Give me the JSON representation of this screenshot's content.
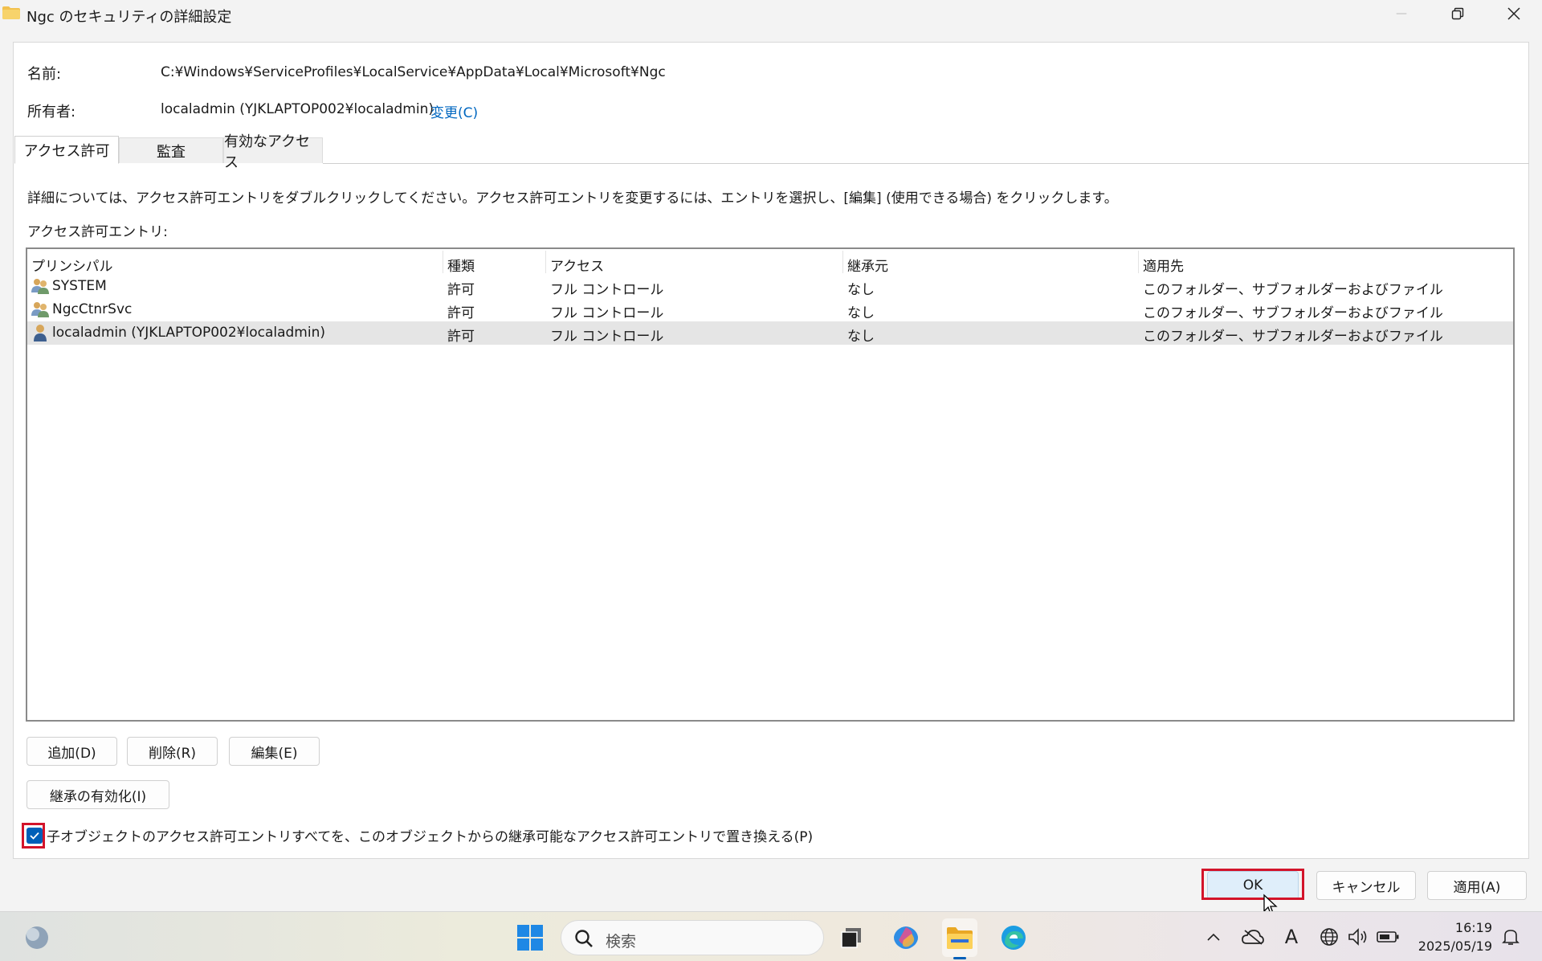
{
  "window": {
    "title": "Ngc のセキュリティの詳細設定",
    "minimize_glyph": "—",
    "icons": {
      "folder": "folder-icon",
      "minimize": "minimize-icon",
      "restore": "restore-icon",
      "close": "close-icon"
    }
  },
  "info": {
    "name_label": "名前:",
    "name_value": "C:¥Windows¥ServiceProfiles¥LocalService¥AppData¥Local¥Microsoft¥Ngc",
    "owner_label": "所有者:",
    "owner_value": "localadmin (YJKLAPTOP002¥localadmin)",
    "change_link": "変更(C)"
  },
  "tabs": [
    {
      "label": "アクセス許可",
      "active": true
    },
    {
      "label": "監査",
      "active": false
    },
    {
      "label": "有効なアクセス",
      "active": false
    }
  ],
  "instructions": "詳細については、アクセス許可エントリをダブルクリックしてください。アクセス許可エントリを変更するには、エントリを選択し、[編集] (使用できる場合) をクリックします。",
  "entries_label": "アクセス許可エントリ:",
  "table": {
    "columns": [
      "プリンシパル",
      "種類",
      "アクセス",
      "継承元",
      "適用先"
    ],
    "rows": [
      {
        "principal": "SYSTEM",
        "icon": "group-users-icon",
        "type": "許可",
        "access": "フル コントロール",
        "inherited": "なし",
        "applies": "このフォルダー、サブフォルダーおよびファイル",
        "selected": false
      },
      {
        "principal": "NgcCtnrSvc",
        "icon": "group-users-icon",
        "type": "許可",
        "access": "フル コントロール",
        "inherited": "なし",
        "applies": "このフォルダー、サブフォルダーおよびファイル",
        "selected": false
      },
      {
        "principal": "localadmin (YJKLAPTOP002¥localadmin)",
        "icon": "user-icon",
        "type": "許可",
        "access": "フル コントロール",
        "inherited": "なし",
        "applies": "このフォルダー、サブフォルダーおよびファイル",
        "selected": true
      }
    ]
  },
  "buttons": {
    "add": "追加(D)",
    "remove": "削除(R)",
    "edit": "編集(E)",
    "enable_inheritance": "継承の有効化(I)",
    "ok": "OK",
    "cancel": "キャンセル",
    "apply": "適用(A)"
  },
  "replace_checkbox": {
    "label": "子オブジェクトのアクセス許可エントリすべてを、このオブジェクトからの継承可能なアクセス許可エントリで置き換える(P)",
    "checked": true
  },
  "taskbar": {
    "search_placeholder": "検索",
    "time": "16:19",
    "date": "2025/05/19",
    "ime_indicator": "A",
    "accent": "#005fb8"
  }
}
